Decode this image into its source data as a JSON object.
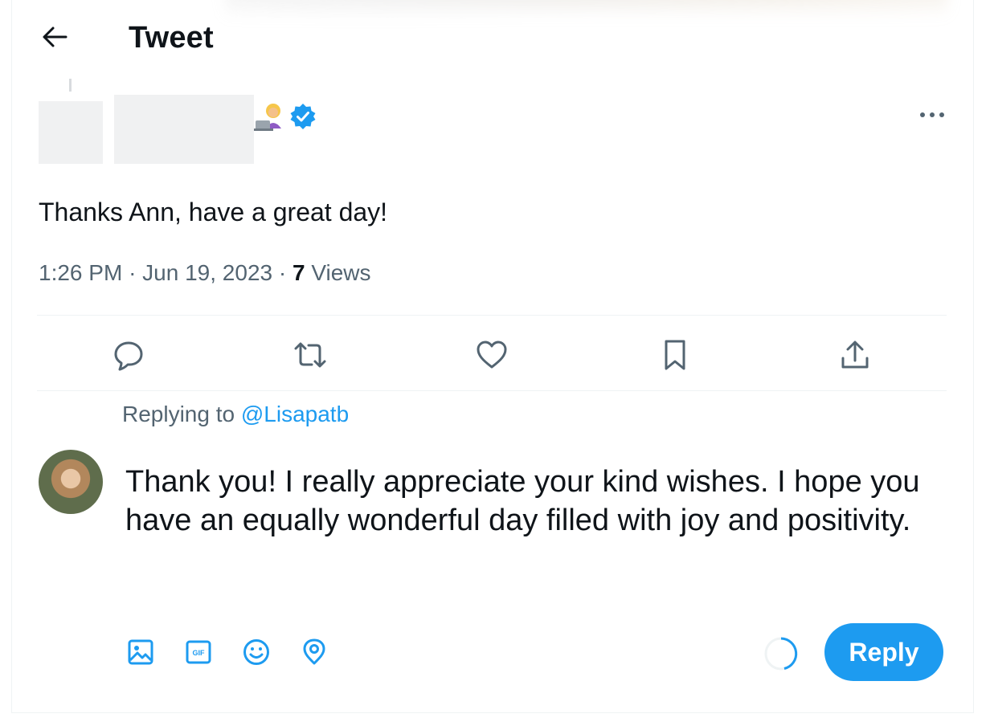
{
  "header": {
    "title": "Tweet"
  },
  "tweet": {
    "text": "Thanks Ann, have a great day!",
    "time": "1:26 PM",
    "date": "Jun 19, 2023",
    "views_count": "7",
    "views_label": "Views",
    "separator": "·"
  },
  "actions": [
    "reply-icon",
    "retweet-icon",
    "like-icon",
    "bookmark-icon",
    "share-icon"
  ],
  "reply": {
    "replying_prefix": "Replying to",
    "replying_handle": "@Lisapatb",
    "draft_text": "Thank you! I really appreciate your kind wishes. I hope you have an equally wonderful day filled with joy and positivity.",
    "button_label": "Reply",
    "tools": [
      "image-icon",
      "gif-icon",
      "emoji-icon",
      "location-icon"
    ]
  },
  "colors": {
    "accent": "#1d9bf0",
    "text": "#0f1419",
    "muted": "#536471",
    "divider": "#eff3f4"
  }
}
